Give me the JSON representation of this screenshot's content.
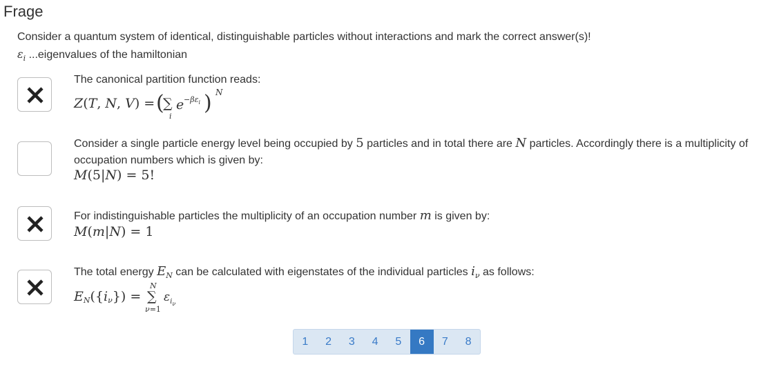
{
  "title": "Frage",
  "intro": {
    "line1": "Consider a quantum system of identical, distinguishable particles without interactions and mark the correct answer(s)!",
    "epsilon_symbol": "ε",
    "epsilon_sub": "i",
    "line2": " ...eigenvalues of the hamiltonian"
  },
  "questions": [
    {
      "checked": true,
      "text": "The canonical partition function reads:",
      "formula": "Z(T,N,V) = (Σ_i e^{−βε_i})^N"
    },
    {
      "checked": false,
      "text_a": "Consider a single particle energy level being occupied by ",
      "text_num": "5",
      "text_b": " particles and in total there are ",
      "text_var": "N",
      "text_c": " particles. Accordingly there is a multiplicity of",
      "text_line2": "occupation numbers which is given by:",
      "formula": "M(5|N) = 5!"
    },
    {
      "checked": true,
      "text_a": "For indistinguishable particles the multiplicity of an occupation number ",
      "text_var": "m",
      "text_b": " is given by:",
      "formula": "M(m|N) = 1"
    },
    {
      "checked": true,
      "text_a": "The total energy ",
      "text_var": "E",
      "text_var_sub": "N",
      "text_b": " can be calculated with eigenstates of the individual particles ",
      "text_var2": "i",
      "text_var2_sub": "ν",
      "text_c": " as follows:",
      "formula": "E_N({i_ν}) = Σ_{ν=1}^{N} ε_{i_ν}"
    }
  ],
  "pagination": {
    "pages": [
      "1",
      "2",
      "3",
      "4",
      "5",
      "6",
      "7",
      "8"
    ],
    "current": "6"
  },
  "colors": {
    "accent": "#3579c3",
    "pager_bg": "#dbe7f3",
    "text": "#333333"
  },
  "icons": {
    "checked": "close-icon"
  }
}
